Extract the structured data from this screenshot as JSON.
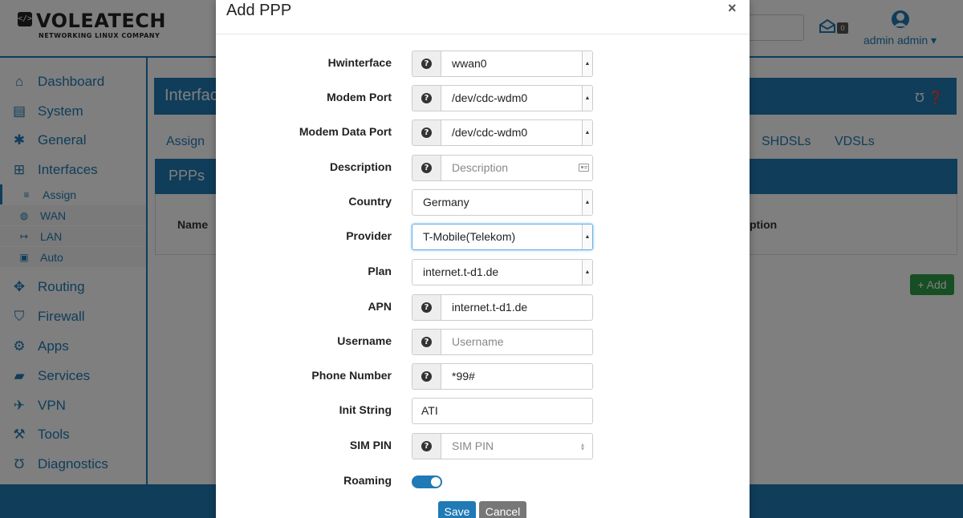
{
  "app": {
    "logo_mark": "</>",
    "logo_name": "VOLEATECH",
    "logo_tagline": "NETWORKING LINUX COMPANY",
    "mail_count": "0",
    "user_label": "admin admin ▾"
  },
  "sidebar": {
    "items": [
      {
        "label": "Dashboard",
        "icon": "home-icon"
      },
      {
        "label": "System",
        "icon": "server-icon"
      },
      {
        "label": "General",
        "icon": "gear-icon"
      },
      {
        "label": "Interfaces",
        "icon": "sitemap-icon"
      },
      {
        "label": "Routing",
        "icon": "arrows-icon"
      },
      {
        "label": "Firewall",
        "icon": "shield-icon"
      },
      {
        "label": "Apps",
        "icon": "gears-icon"
      },
      {
        "label": "Services",
        "icon": "briefcase-icon"
      },
      {
        "label": "VPN",
        "icon": "plane-icon"
      },
      {
        "label": "Tools",
        "icon": "wrench-icon"
      },
      {
        "label": "Diagnostics",
        "icon": "stethoscope-icon"
      }
    ],
    "subitems": [
      {
        "label": "Assign",
        "icon": "sliders-icon"
      },
      {
        "label": "WAN",
        "icon": "globe-icon"
      },
      {
        "label": "LAN",
        "icon": "sign-in-icon"
      },
      {
        "label": "Auto",
        "icon": "square-icon"
      }
    ]
  },
  "page": {
    "title": "Interfac",
    "tabs": [
      "Assign",
      "SHDSLs",
      "VDSLs"
    ],
    "panel_title": "PPPs",
    "col_name": "Name",
    "col_desc": "ption",
    "add_label": "+ Add"
  },
  "modal": {
    "title": "Add PPP",
    "close": "×",
    "fields": {
      "hwinterface": {
        "label": "Hwinterface",
        "value": "wwan0"
      },
      "modem_port": {
        "label": "Modem Port",
        "value": "/dev/cdc-wdm0"
      },
      "modem_data_port": {
        "label": "Modem Data Port",
        "value": "/dev/cdc-wdm0"
      },
      "description": {
        "label": "Description",
        "placeholder": "Description"
      },
      "country": {
        "label": "Country",
        "value": "Germany"
      },
      "provider": {
        "label": "Provider",
        "value": "T-Mobile(Telekom)"
      },
      "plan": {
        "label": "Plan",
        "value": "internet.t-d1.de"
      },
      "apn": {
        "label": "APN",
        "value": "internet.t-d1.de"
      },
      "username": {
        "label": "Username",
        "placeholder": "Username"
      },
      "phone": {
        "label": "Phone Number",
        "value": "*99#"
      },
      "init_string": {
        "label": "Init String",
        "value": "ATI"
      },
      "sim_pin": {
        "label": "SIM PIN",
        "placeholder": "SIM PIN"
      },
      "roaming": {
        "label": "Roaming",
        "enabled": true
      }
    },
    "save_label": "Save",
    "cancel_label": "Cancel"
  },
  "colors": {
    "primary": "#1f7ab5",
    "success": "#2e9d48",
    "cancel": "#777777"
  }
}
